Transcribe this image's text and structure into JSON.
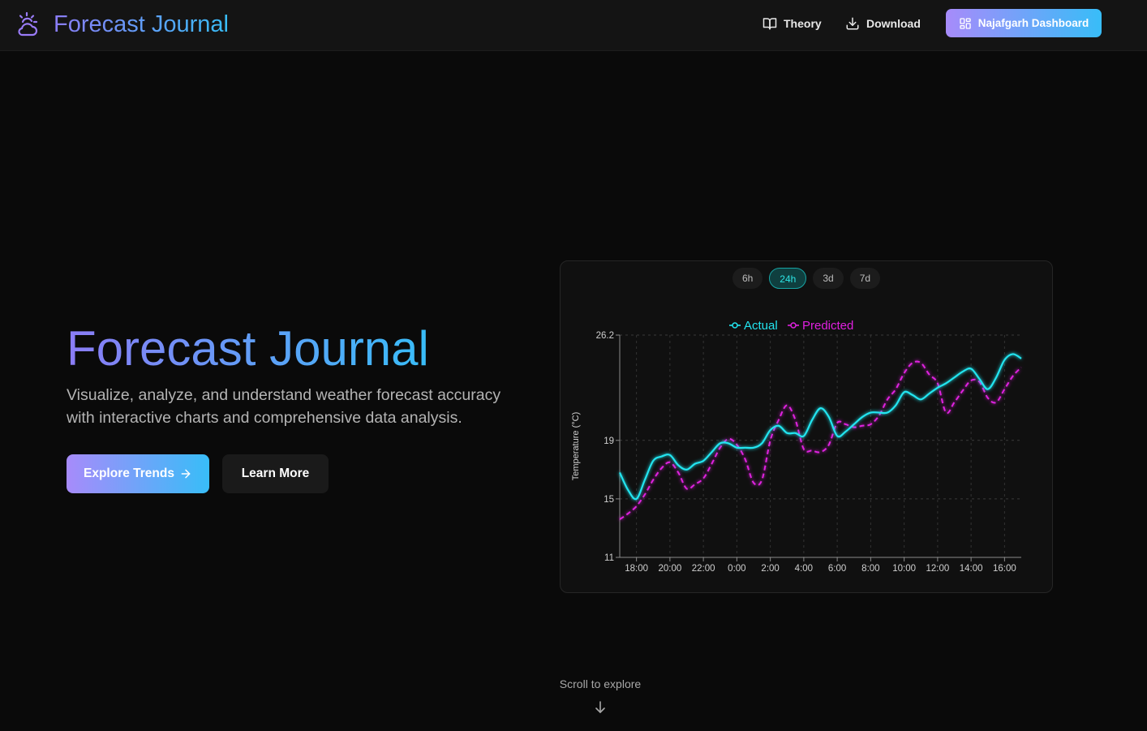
{
  "nav": {
    "brand": "Forecast Journal",
    "theory": "Theory",
    "download": "Download",
    "dashboard": "Najafgarh Dashboard"
  },
  "hero": {
    "title": "Forecast Journal",
    "subtitle": "Visualize, analyze, and understand weather forecast accuracy with interactive charts and comprehensive data analysis.",
    "primary_button": "Explore Trends",
    "secondary_button": "Learn More"
  },
  "range_tabs": [
    {
      "label": "6h",
      "active": false
    },
    {
      "label": "24h",
      "active": true
    },
    {
      "label": "3d",
      "active": false
    },
    {
      "label": "7d",
      "active": false
    }
  ],
  "scroll_hint": "Scroll to explore",
  "colors": {
    "accent_purple": "#a78bfa",
    "accent_blue": "#38bdf8",
    "actual": "#22e5f0",
    "predicted": "#e020e0"
  },
  "icons": {
    "brand": "cloud-sun-icon",
    "theory": "book-icon",
    "download": "download-icon",
    "dashboard": "grid-icon",
    "explore": "arrow-right-icon",
    "scroll": "arrow-down-icon"
  },
  "chart_data": {
    "type": "line",
    "ylabel": "Temperature (°C)",
    "xlabel": "",
    "ylim": [
      11,
      26.2
    ],
    "y_ticks": [
      "26.2",
      "19",
      "15",
      "11"
    ],
    "x_ticks": [
      "18:00",
      "20:00",
      "22:00",
      "0:00",
      "2:00",
      "4:00",
      "6:00",
      "8:00",
      "10:00",
      "12:00",
      "14:00",
      "16:00"
    ],
    "x": [
      "17:00",
      "17:30",
      "18:00",
      "18:30",
      "19:00",
      "19:30",
      "20:00",
      "20:30",
      "21:00",
      "21:30",
      "22:00",
      "22:30",
      "23:00",
      "23:30",
      "0:00",
      "0:30",
      "1:00",
      "1:30",
      "2:00",
      "2:30",
      "3:00",
      "3:30",
      "4:00",
      "4:30",
      "5:00",
      "5:30",
      "6:00",
      "6:30",
      "7:00",
      "7:30",
      "8:00",
      "8:30",
      "9:00",
      "9:30",
      "10:00",
      "10:30",
      "11:00",
      "11:30",
      "12:00",
      "12:30",
      "13:00",
      "13:30",
      "14:00",
      "14:30",
      "15:00",
      "15:30",
      "16:00",
      "16:30",
      "17:00"
    ],
    "grid": true,
    "legend_position": "top-center",
    "series": [
      {
        "name": "Actual",
        "values": [
          16.8,
          15.6,
          15.0,
          16.3,
          17.6,
          17.9,
          18.0,
          17.3,
          17.0,
          17.4,
          17.6,
          18.2,
          18.8,
          18.8,
          18.5,
          18.5,
          18.5,
          18.8,
          19.7,
          20.0,
          19.5,
          19.5,
          19.3,
          20.4,
          21.2,
          20.6,
          19.3,
          19.6,
          20.1,
          20.6,
          20.9,
          20.9,
          20.9,
          21.4,
          22.3,
          22.1,
          21.8,
          22.2,
          22.6,
          22.9,
          23.3,
          23.7,
          23.9,
          23.2,
          22.5,
          23.3,
          24.5,
          24.9,
          24.6
        ]
      },
      {
        "name": "Predicted",
        "values": [
          13.6,
          14.0,
          14.5,
          15.3,
          16.3,
          17.1,
          17.5,
          16.8,
          15.7,
          16.0,
          16.4,
          17.4,
          18.5,
          19.1,
          18.7,
          17.7,
          16.1,
          16.3,
          19.0,
          20.4,
          21.4,
          20.4,
          18.4,
          18.3,
          18.2,
          18.7,
          20.2,
          20.1,
          19.9,
          20.0,
          20.1,
          20.7,
          21.8,
          22.5,
          23.6,
          24.3,
          24.3,
          23.5,
          22.9,
          20.9,
          21.6,
          22.4,
          23.1,
          23.0,
          21.9,
          21.6,
          22.5,
          23.4,
          24.0
        ]
      }
    ]
  }
}
